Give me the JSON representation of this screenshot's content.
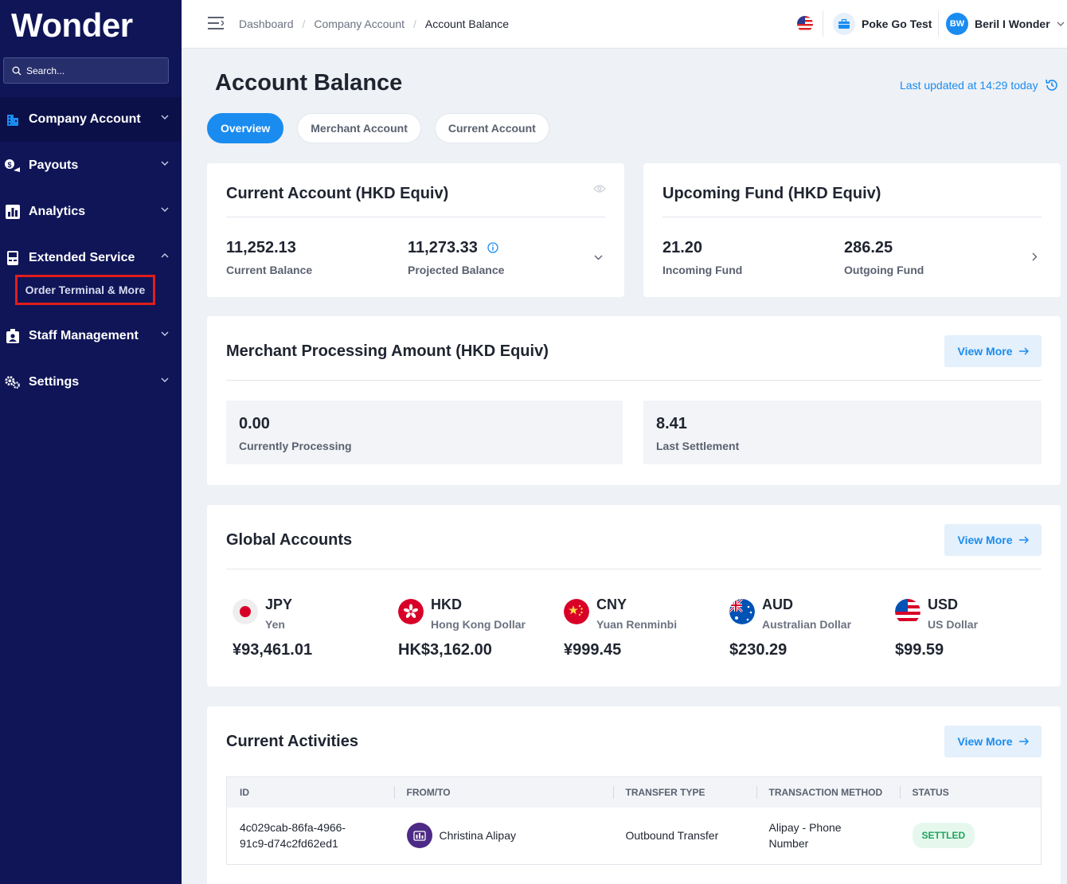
{
  "sidebar": {
    "logo": "Wonder",
    "search_placeholder": "Search...",
    "items": [
      {
        "label": "Company Account",
        "icon": "building-icon"
      },
      {
        "label": "Payouts",
        "icon": "payout-icon"
      },
      {
        "label": "Analytics",
        "icon": "analytics-icon"
      },
      {
        "label": "Extended Service",
        "icon": "terminal-icon"
      },
      {
        "label": "Staff Management",
        "icon": "staff-icon"
      },
      {
        "label": "Settings",
        "icon": "gears-icon"
      }
    ],
    "sub_item": "Order Terminal & More"
  },
  "topbar": {
    "breadcrumbs": [
      "Dashboard",
      "Company Account",
      "Account Balance"
    ],
    "business": "Poke Go Test",
    "user_initials": "BW",
    "user_name": "Beril I Wonder"
  },
  "page": {
    "title": "Account Balance",
    "last_updated": "Last updated at 14:29 today",
    "tabs": [
      "Overview",
      "Merchant Account",
      "Current Account"
    ]
  },
  "current_account": {
    "title": "Current Account (HKD Equiv)",
    "balance": "11,252.13",
    "balance_label": "Current Balance",
    "projected": "11,273.33",
    "projected_label": "Projected Balance"
  },
  "upcoming": {
    "title": "Upcoming Fund (HKD Equiv)",
    "incoming": "21.20",
    "incoming_label": "Incoming Fund",
    "outgoing": "286.25",
    "outgoing_label": "Outgoing Fund"
  },
  "merchant": {
    "title": "Merchant Processing Amount (HKD Equiv)",
    "view_more": "View More",
    "processing": "0.00",
    "processing_label": "Currently Processing",
    "settlement": "8.41",
    "settlement_label": "Last Settlement"
  },
  "global": {
    "title": "Global Accounts",
    "view_more": "View More",
    "accounts": [
      {
        "code": "JPY",
        "name": "Yen",
        "amount": "¥93,461.01"
      },
      {
        "code": "HKD",
        "name": "Hong Kong Dollar",
        "amount": "HK$3,162.00"
      },
      {
        "code": "CNY",
        "name": "Yuan Renminbi",
        "amount": "¥999.45"
      },
      {
        "code": "AUD",
        "name": "Australian Dollar",
        "amount": "$230.29"
      },
      {
        "code": "USD",
        "name": "US Dollar",
        "amount": "$99.59"
      }
    ]
  },
  "activities": {
    "title": "Current Activities",
    "view_more": "View More",
    "columns": [
      "ID",
      "FROM/TO",
      "TRANSFER TYPE",
      "TRANSACTION METHOD",
      "STATUS"
    ],
    "rows": [
      {
        "id_line1": "4c029cab-86fa-4966-",
        "id_line2": "91c9-d74c2fd62ed1",
        "party": "Christina Alipay",
        "type": "Outbound Transfer",
        "method_line1": "Alipay - Phone",
        "method_line2": "Number",
        "status": "SETTLED"
      }
    ]
  },
  "colors": {
    "sidebar": "#0f1557",
    "accent": "#1a8cf0",
    "highlight": "#e11d1d"
  }
}
